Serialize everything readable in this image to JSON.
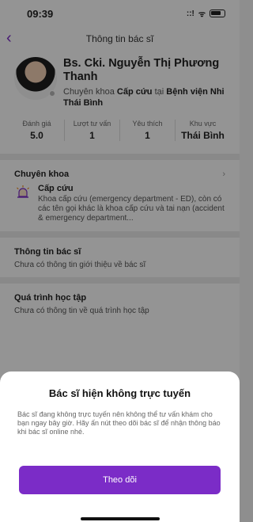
{
  "status": {
    "time": "09:39",
    "signal": "::!",
    "wifi": "ᯤ"
  },
  "header": {
    "title": "Thông tin bác sĩ",
    "back_icon": "‹"
  },
  "doctor": {
    "name": "Bs. Cki. Nguyễn Thị Phương Thanh",
    "specialty_prefix": "Chuyên khoa ",
    "specialty": "Cấp cứu",
    "at_text": " tại ",
    "hospital": "Bệnh viện Nhi Thái Bình"
  },
  "stats": [
    {
      "label": "Đánh giá",
      "value": "5.0"
    },
    {
      "label": "Lượt tư vấn",
      "value": "1"
    },
    {
      "label": "Yêu thích",
      "value": "1"
    },
    {
      "label": "Khu vực",
      "value": "Thái Bình"
    }
  ],
  "specialty_section": {
    "title": "Chuyên khoa",
    "item_name": "Cấp cứu",
    "item_desc": "Khoa cấp cứu (emergency department - ED), còn có các tên gọi khác là khoa cấp cứu và tai nạn (accident & emergency department..."
  },
  "info_section": {
    "title": "Thông tin bác sĩ",
    "text": "Chưa có thông tin giới thiệu về bác sĩ"
  },
  "education_section": {
    "title": "Quá trình học tập",
    "text": "Chưa có thông tin về quá trình học tập"
  },
  "sheet": {
    "title": "Bác sĩ hiện không trực tuyến",
    "body": "Bác sĩ đang không trực tuyến nên không thể tư vấn khám cho bạn ngay bây giờ. Hãy ấn nút theo dõi bác sĩ để nhận thông báo khi bác sĩ online nhé.",
    "button": "Theo dõi"
  },
  "colors": {
    "accent": "#7b2cc7"
  }
}
